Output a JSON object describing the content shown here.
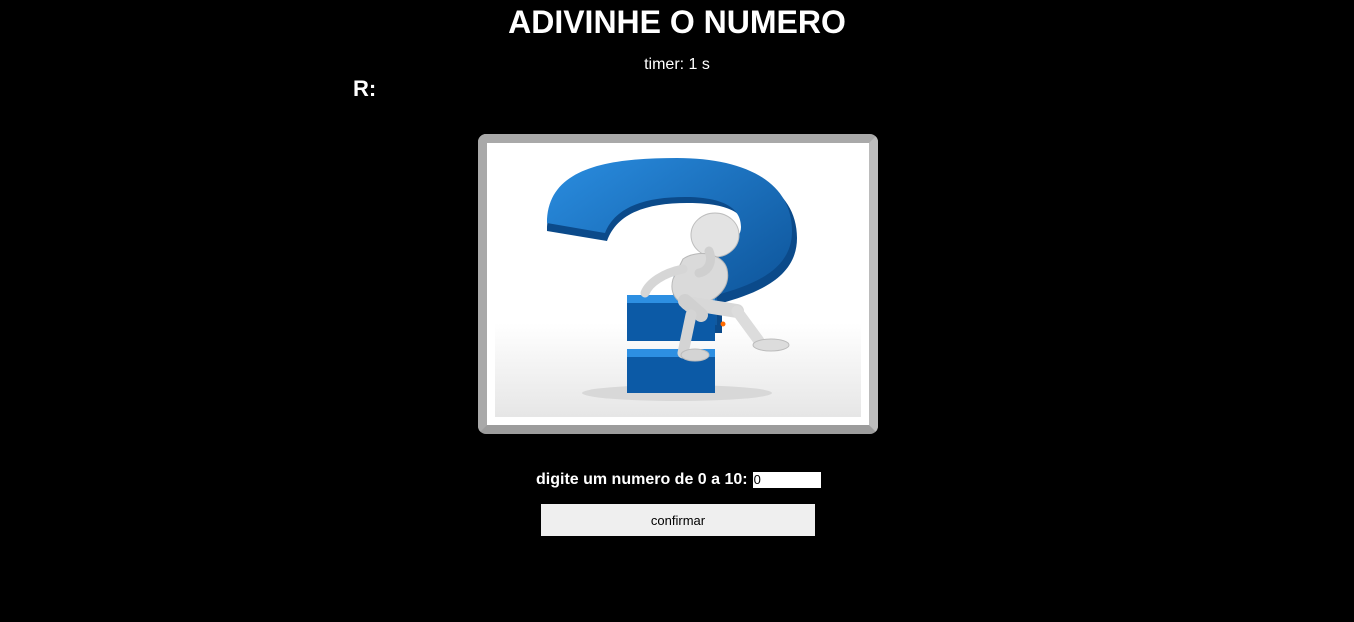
{
  "header": {
    "title": "ADIVINHE O NUMERO",
    "timer_text": "timer: 1 s"
  },
  "answer": {
    "label": "R:"
  },
  "illustration": {
    "icon": "question-mark-thinker-icon",
    "colors": {
      "question_mark": "#1a6fbf",
      "figure": "#d9d9d9",
      "frame": "#a9a9a9"
    }
  },
  "guess_form": {
    "prompt_label": "digite um numero de 0 a 10:",
    "input_value": "0",
    "confirm_label": "confirmar"
  },
  "colors": {
    "background": "#000000",
    "text": "#ffffff",
    "button_bg": "#efefef"
  }
}
